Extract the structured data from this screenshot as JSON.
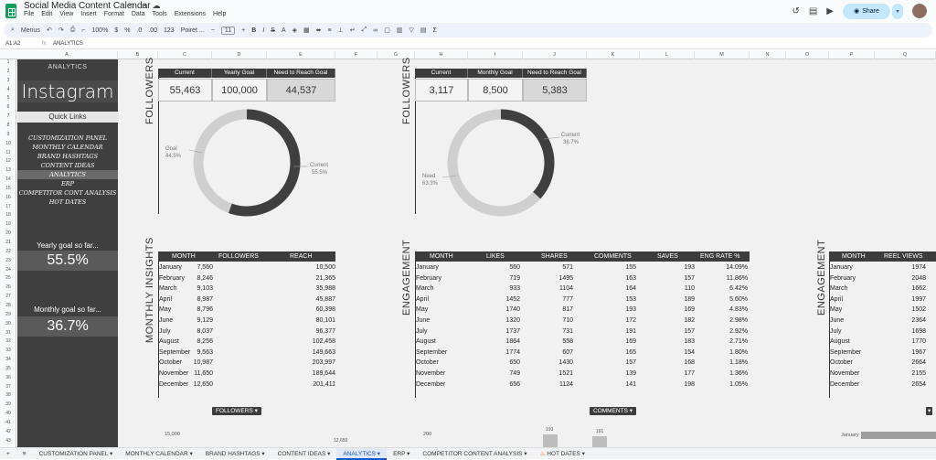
{
  "app": {
    "title": "Social Media Content Calendar",
    "menu": [
      "File",
      "Edit",
      "View",
      "Insert",
      "Format",
      "Data",
      "Tools",
      "Extensions",
      "Help"
    ],
    "share_label": "Share"
  },
  "toolbar": {
    "search": "Menus",
    "zoom": "100%",
    "currency": "$",
    "percent": "%",
    "dec_down": ".0",
    "dec_up": ".00",
    "number_fmt": "123",
    "font": "Poiret ...",
    "font_size": "11",
    "bold": "B"
  },
  "formula_bar": {
    "name_box": "A1:A2",
    "fx": "fx",
    "value": "ANALYTICS"
  },
  "columns": [
    "A",
    "B",
    "C",
    "D",
    "E",
    "F",
    "G",
    "H",
    "I",
    "J",
    "K",
    "L",
    "M",
    "N",
    "O",
    "P",
    "Q"
  ],
  "rows": [
    "1",
    "2",
    "3",
    "4",
    "5",
    "6",
    "7",
    "8",
    "9",
    "10",
    "11",
    "12",
    "13",
    "14",
    "15",
    "16",
    "17",
    "18",
    "19",
    "20",
    "21",
    "22",
    "23",
    "24",
    "25",
    "26",
    "27",
    "28",
    "29",
    "30",
    "31",
    "32",
    "33",
    "34",
    "35",
    "36",
    "37",
    "38",
    "39",
    "40",
    "41",
    "42",
    "43"
  ],
  "sidebar": {
    "analytics_label": "ANALYTICS",
    "platform": "Instagram",
    "quick_links_title": "Quick Links",
    "links": [
      "CUSTOMIZATION PANEL",
      "MONTHLY CALENDAR",
      "BRAND HASHTAGS",
      "CONTENT IDEAS",
      "ANALYTICS",
      "ERP",
      "COMPETITOR CONT ANALYSIS",
      "HOT DATES"
    ],
    "yearly_label": "Yearly goal so far...",
    "yearly_value": "55.5%",
    "monthly_label": "Monthly goal so far...",
    "monthly_value": "36.7%"
  },
  "followers_yearly": {
    "title": "FOLLOWERS",
    "headers": [
      "Current",
      "Yearly Goal",
      "Need to Reach Goal"
    ],
    "values": [
      "55,463",
      "100,000",
      "44,537"
    ],
    "donut": {
      "goal_label": "Goal",
      "goal_pct": "44.5%",
      "current_label": "Current",
      "current_pct": "55.5%",
      "current_fraction": 0.555
    }
  },
  "followers_monthly": {
    "title": "FOLLOWERS",
    "headers": [
      "Current",
      "Monthly Goal",
      "Need to Reach Goal"
    ],
    "values": [
      "3,117",
      "8,500",
      "5,383"
    ],
    "donut": {
      "need_label": "Need",
      "need_pct": "63.3%",
      "current_label": "Current",
      "current_pct": "36.7%",
      "current_fraction": 0.367
    }
  },
  "monthly_insights": {
    "title": "MONTHLY INSIGHTS",
    "headers": [
      "MONTH",
      "FOLLOWERS",
      "REACH"
    ],
    "rows": [
      [
        "January",
        "7,560",
        "10,500"
      ],
      [
        "February",
        "8,246",
        "21,365"
      ],
      [
        "March",
        "9,103",
        "35,988"
      ],
      [
        "April",
        "8,987",
        "45,887"
      ],
      [
        "May",
        "8,796",
        "60,398"
      ],
      [
        "June",
        "9,129",
        "80,101"
      ],
      [
        "July",
        "8,037",
        "96,377"
      ],
      [
        "August",
        "8,256",
        "102,458"
      ],
      [
        "September",
        "9,563",
        "149,663"
      ],
      [
        "October",
        "10,987",
        "203,997"
      ],
      [
        "November",
        "11,650",
        "189,644"
      ],
      [
        "December",
        "12,650",
        "201,411"
      ]
    ],
    "chip": "FOLLOWERS"
  },
  "engagement": {
    "title": "ENGAGEMENT",
    "headers": [
      "MONTH",
      "LIKES",
      "SHARES",
      "COMMENTS",
      "SAVES",
      "ENG RATE %"
    ],
    "rows": [
      [
        "January",
        "560",
        "571",
        "155",
        "193",
        "14.09%"
      ],
      [
        "February",
        "719",
        "1495",
        "163",
        "157",
        "11.86%"
      ],
      [
        "March",
        "933",
        "1104",
        "164",
        "110",
        "6.42%"
      ],
      [
        "April",
        "1452",
        "777",
        "153",
        "189",
        "5.60%"
      ],
      [
        "May",
        "1740",
        "817",
        "193",
        "169",
        "4.83%"
      ],
      [
        "June",
        "1320",
        "710",
        "172",
        "182",
        "2.98%"
      ],
      [
        "July",
        "1737",
        "731",
        "191",
        "157",
        "2.92%"
      ],
      [
        "August",
        "1864",
        "558",
        "169",
        "183",
        "2.71%"
      ],
      [
        "September",
        "1774",
        "607",
        "165",
        "154",
        "1.80%"
      ],
      [
        "October",
        "650",
        "1430",
        "157",
        "168",
        "1.18%"
      ],
      [
        "November",
        "749",
        "1521",
        "139",
        "177",
        "1.36%"
      ],
      [
        "December",
        "656",
        "1124",
        "141",
        "198",
        "1.05%"
      ]
    ],
    "chip": "COMMENTS"
  },
  "engagement_reels": {
    "title": "ENGAGEMENT",
    "headers": [
      "MONTH",
      "REEL VIEWS"
    ],
    "rows": [
      [
        "January",
        "1974"
      ],
      [
        "February",
        "2048"
      ],
      [
        "March",
        "1662"
      ],
      [
        "April",
        "1997"
      ],
      [
        "May",
        "1502"
      ],
      [
        "June",
        "2364"
      ],
      [
        "July",
        "1698"
      ],
      [
        "August",
        "1770"
      ],
      [
        "September",
        "1967"
      ],
      [
        "October",
        "2664"
      ],
      [
        "November",
        "2155"
      ],
      [
        "December",
        "2654"
      ]
    ]
  },
  "bottom_charts": {
    "left_tick": "15,000",
    "left_label": "12,650",
    "mid_tick": "200",
    "mid_labels": [
      "193",
      "191"
    ],
    "right_label": "January"
  },
  "tabs": [
    "CUSTOMIZATION PANEL",
    "MONTHLY CALENDAR",
    "BRAND HASHTAGS",
    "CONTENT IDEAS",
    "ANALYTICS",
    "ERP",
    "COMPETITOR CONTENT ANALYSIS",
    "HOT DATES"
  ],
  "colors": {
    "dark": "#3c3c3c",
    "donut_light": "#cfcfcf",
    "donut_dark": "#3f3f3f",
    "accent": "#0b57d0"
  }
}
